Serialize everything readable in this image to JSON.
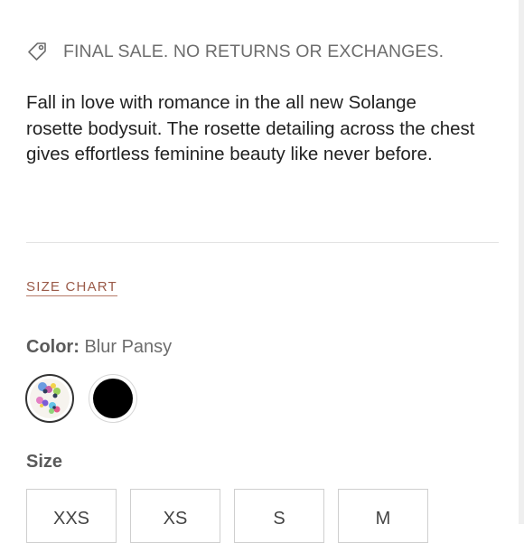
{
  "notice": {
    "icon": "tag-icon",
    "text": "FINAL SALE. NO RETURNS OR EXCHANGES."
  },
  "description": "Fall in love with romance in the all new Solange rosette bodysuit. The rosette detailing across the chest  gives effortless feminine beauty like never before.",
  "size_chart_label": "SIZE CHART",
  "color": {
    "label": "Color:",
    "selected_value": "Blur Pansy",
    "swatches": [
      {
        "name": "Blur Pansy",
        "type": "floral-print",
        "selected": true
      },
      {
        "name": "black",
        "hex": "#000000",
        "selected": false
      }
    ]
  },
  "size": {
    "label": "Size",
    "options": [
      "XXS",
      "XS",
      "S",
      "M"
    ]
  },
  "colors": {
    "accent": "#9a5a48",
    "muted_text": "#6d6d6d",
    "body_text": "#222222"
  }
}
